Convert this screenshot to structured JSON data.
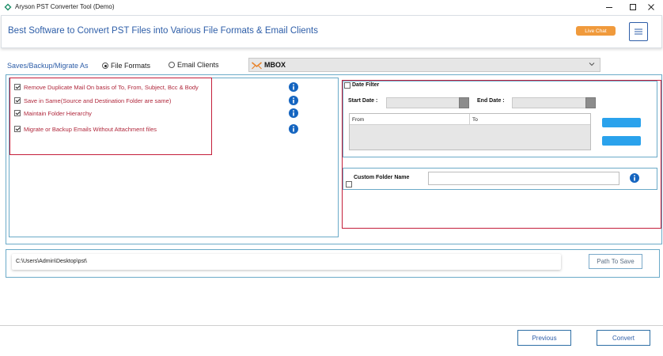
{
  "window": {
    "title": "Aryson PST Converter Tool (Demo)"
  },
  "header": {
    "title": "Best Software to Convert PST Files into Various File Formats & Email Clients",
    "live_chat_label": "Live Chat",
    "accent_color": "#2e5ea8",
    "live_chat_color": "#f09a3c"
  },
  "save_as": {
    "label": "Saves/Backup/Migrate As",
    "options": [
      {
        "label": "File Formats",
        "selected": true
      },
      {
        "label": "Email Clients",
        "selected": false
      }
    ],
    "format_selected": "MBOX",
    "format_icon": "mbox-icon"
  },
  "options": [
    {
      "label": "Remove Duplicate Mail On basis of To, From, Subject, Bcc & Body",
      "checked": true
    },
    {
      "label": "Save in Same(Source and Destination Folder are same)",
      "checked": true
    },
    {
      "label": "Maintain Folder Hierarchy",
      "checked": true
    },
    {
      "label": "Migrate or Backup Emails Without Attachment files",
      "checked": true
    }
  ],
  "date_filter": {
    "label": "Date Filter",
    "checked": false,
    "start_label": "Start Date :",
    "end_label": "End Date :",
    "start_value": "",
    "end_value": "",
    "columns": [
      "From",
      "To"
    ]
  },
  "custom_folder": {
    "label": "Custom Folder Name",
    "checked": false,
    "value": ""
  },
  "path": {
    "value": "C:\\Users\\Admin\\Desktop\\pst\\",
    "button_label": "Path To Save"
  },
  "footer": {
    "previous_label": "Previous",
    "convert_label": "Convert"
  },
  "colors": {
    "highlight_red": "#c41e3a",
    "panel_border": "#6baac8",
    "info_blue": "#1565c0",
    "action_blue": "#2aa2ec"
  }
}
